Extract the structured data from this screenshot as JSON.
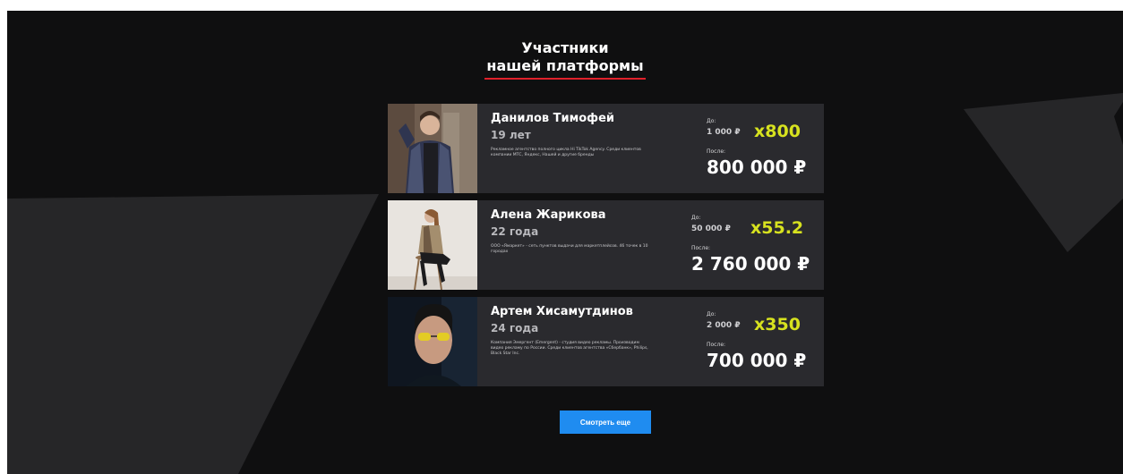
{
  "section": {
    "title_line1": "Участники",
    "title_line2": "нашей платформы"
  },
  "participants": [
    {
      "name": "Данилов Тимофей",
      "age": "19 лет",
      "description": "Рекламное агентство полного цикла Hi TikTok Agency. Среди клиентов компании МТС, Яндекс, Нашей и другие бренды",
      "before_label": "До:",
      "before_value": "1 000 ₽",
      "multiplier": "x800",
      "after_label": "После:",
      "after_value": "800 000 ₽"
    },
    {
      "name": "Алена Жарикова",
      "age": "22 года",
      "description": "ООО «Ямаркет» - сеть пунктов выдачи для маркетплейсов. 46 точек в 10 городах",
      "before_label": "До:",
      "before_value": "50 000 ₽",
      "multiplier": "x55.2",
      "after_label": "После:",
      "after_value": "2 760 000 ₽"
    },
    {
      "name": "Артем Хисамутдинов",
      "age": "24 года",
      "description": "Компания Эмергент (Emergent) - студия видео рекламы. Производим видео рекламу по России. Среди клиентов агентства «Сбербанк», Philips, Black Star Inc.",
      "before_label": "До:",
      "before_value": "2 000 ₽",
      "multiplier": "x350",
      "after_label": "После:",
      "after_value": "700 000 ₽"
    }
  ],
  "actions": {
    "more_label": "Смотреть еще"
  },
  "colors": {
    "accent_multiplier": "#d7e21f",
    "button": "#1f8cf0",
    "underline": "#e0202a",
    "card_bg": "#2a2a2e",
    "page_bg": "#0f0f10"
  }
}
